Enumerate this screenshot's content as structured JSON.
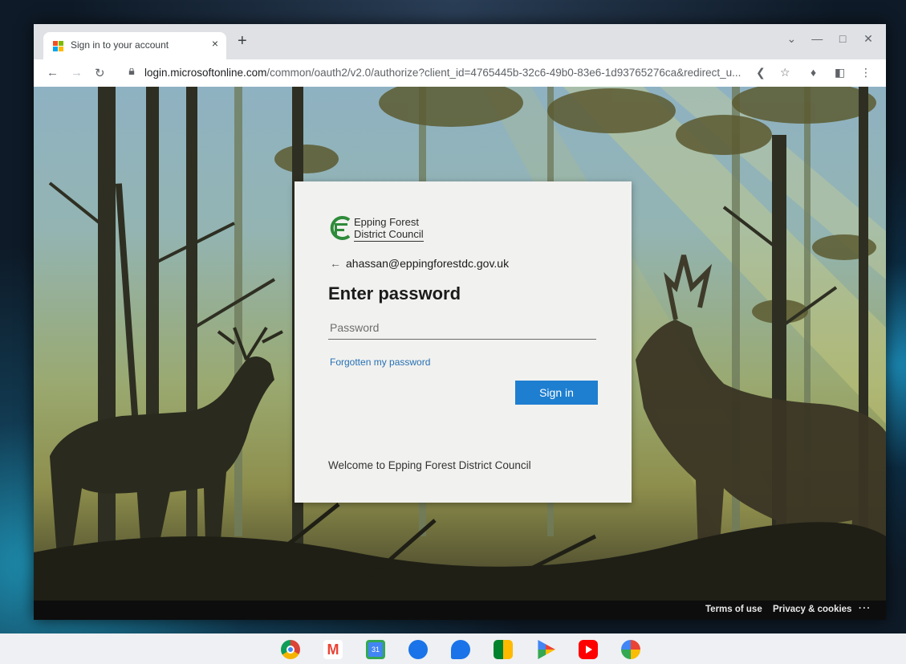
{
  "browser": {
    "tab_title": "Sign in to your account",
    "tab_close": "×",
    "new_tab": "+",
    "url_host": "login.microsoftonline.com",
    "url_path": "/common/oauth2/v2.0/authorize?client_id=4765445b-32c6-49b0-83e6-1d93765276ca&redirect_u...",
    "icons": [
      "back-icon",
      "forward-icon",
      "reload-icon",
      "lock-icon",
      "share-icon",
      "star-icon",
      "extensions-icon",
      "side-panel-icon",
      "menu-icon"
    ]
  },
  "login": {
    "logo_line1": "Epping Forest",
    "logo_line2": "District Council",
    "account": "ahassan@eppingforestdc.gov.uk",
    "back_arrow": "←",
    "heading": "Enter password",
    "password_placeholder": "Password",
    "forgot_link": "Forgotten my password",
    "signin_button": "Sign in",
    "welcome": "Welcome to Epping Forest District Council"
  },
  "footer": {
    "terms": "Terms of use",
    "privacy": "Privacy & cookies",
    "more": "..."
  },
  "colors": {
    "accent": "#1e7fd0",
    "link": "#2670b3",
    "logo_green": "#2e8b3a"
  },
  "shelf": {
    "apps": [
      "chrome-icon",
      "gmail-icon",
      "calendar-icon",
      "files-icon",
      "messages-icon",
      "meet-icon",
      "play-store-icon",
      "youtube-icon",
      "photos-icon"
    ]
  }
}
